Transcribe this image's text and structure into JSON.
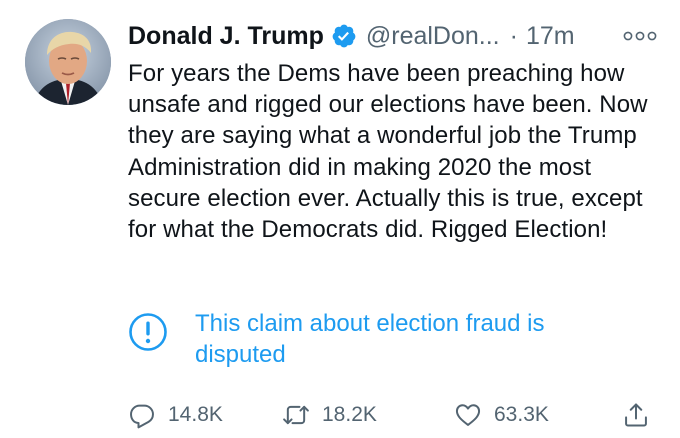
{
  "tweet": {
    "author": {
      "display_name": "Donald J. Trump",
      "handle": "@realDon...",
      "verified": true,
      "avatar_icon": "profile-photo"
    },
    "separator": "·",
    "time": "17m",
    "text": "For years the Dems have been preaching how unsafe and rigged our elections have been. Now they are saying what a wonderful job the Trump Administration did in making 2020 the most secure election ever. Actually this is true, except for what the Democrats did. Rigged Election!",
    "notice": {
      "icon": "exclamation-circle-icon",
      "text": "This claim about election fraud is disputed"
    },
    "actions": {
      "reply_count": "14.8K",
      "retweet_count": "18.2K",
      "like_count": "63.3K"
    }
  },
  "colors": {
    "text_primary": "#0f1419",
    "text_secondary": "#536471",
    "accent": "#1d9bf0"
  }
}
